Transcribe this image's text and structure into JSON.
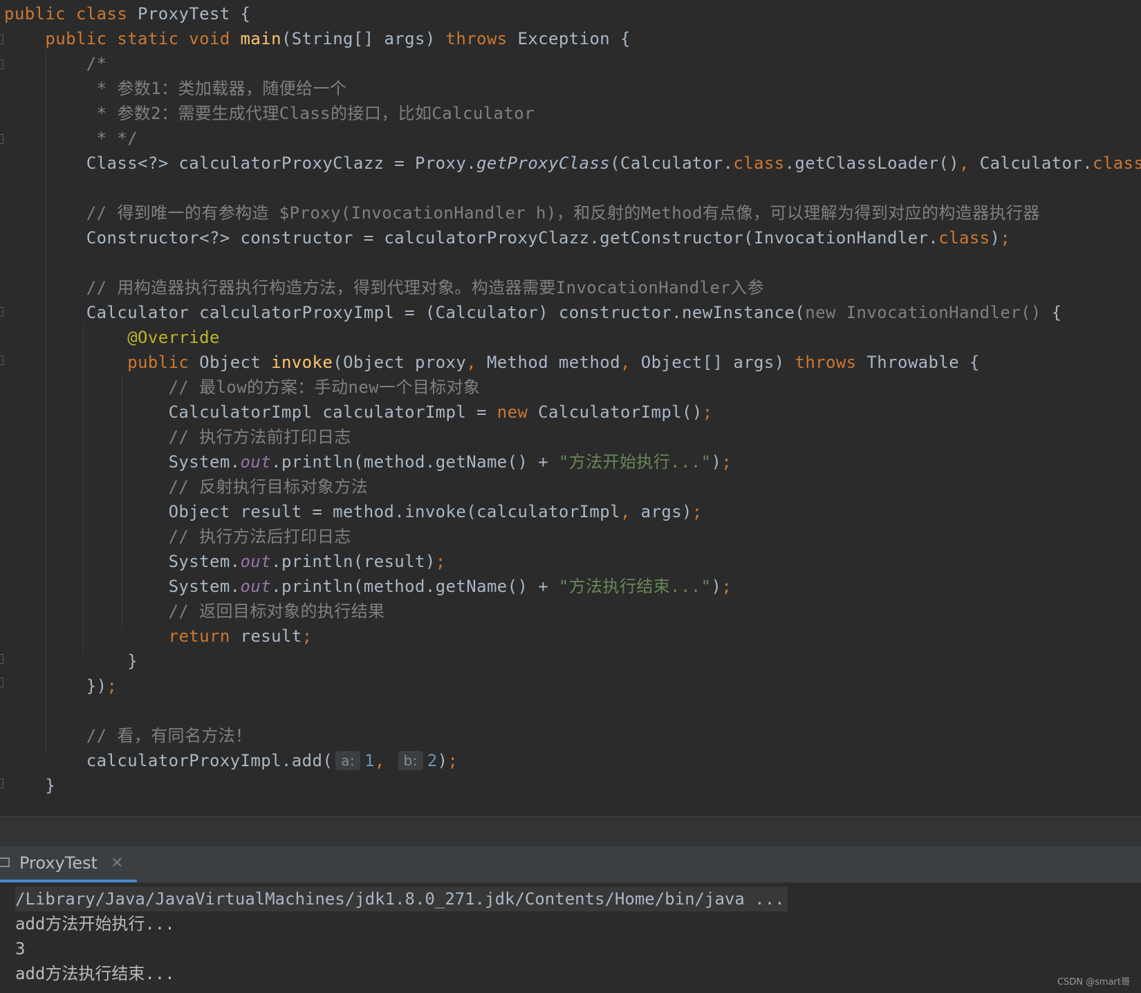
{
  "code_lines": [
    [
      {
        "t": "public class ",
        "c": "kw"
      },
      {
        "t": "ProxyTest {"
      }
    ],
    [
      {
        "t": "    "
      },
      {
        "t": "public static void ",
        "c": "kw"
      },
      {
        "t": "main",
        "c": "fn"
      },
      {
        "t": "(String[] args) "
      },
      {
        "t": "throws ",
        "c": "kw"
      },
      {
        "t": "Exception {"
      }
    ],
    [
      {
        "t": "        /*",
        "c": "cmt"
      }
    ],
    [
      {
        "t": "         * 参数1：类加载器，随便给一个",
        "c": "cmt"
      }
    ],
    [
      {
        "t": "         * 参数2：需要生成代理Class的接口，比如Calculator",
        "c": "cmt"
      }
    ],
    [
      {
        "t": "         * */",
        "c": "cmt"
      }
    ],
    [
      {
        "t": "        Class<?> calculatorProxyClazz = Proxy."
      },
      {
        "t": "getProxyClass",
        "c": "ital"
      },
      {
        "t": "(Calculator."
      },
      {
        "t": "class",
        "c": "kw"
      },
      {
        "t": ".getClassLoader()"
      },
      {
        "t": ", ",
        "c": "kw"
      },
      {
        "t": "Calculator."
      },
      {
        "t": "class",
        "c": "kw"
      },
      {
        "t": ")"
      },
      {
        "t": ";",
        "c": "kw"
      }
    ],
    [],
    [
      {
        "t": "        // 得到唯一的有参构造 $Proxy(InvocationHandler h)，和反射的Method有点像，可以理解为得到对应的构造器执行器",
        "c": "cmt"
      }
    ],
    [
      {
        "t": "        Constructor<?> constructor = calculatorProxyClazz.getConstructor(InvocationHandler."
      },
      {
        "t": "class",
        "c": "kw"
      },
      {
        "t": ")"
      },
      {
        "t": ";",
        "c": "kw"
      }
    ],
    [],
    [
      {
        "t": "        // 用构造器执行器执行构造方法，得到代理对象。构造器需要InvocationHandler入参",
        "c": "cmt"
      }
    ],
    [
      {
        "t": "        Calculator calculatorProxyImpl = (Calculator) constructor.newInstance("
      },
      {
        "t": "new InvocationHandler()",
        "c": "dim"
      },
      {
        "t": " {"
      }
    ],
    [
      {
        "t": "            "
      },
      {
        "t": "@Override",
        "c": "ann"
      }
    ],
    [
      {
        "t": "            "
      },
      {
        "t": "public ",
        "c": "kw"
      },
      {
        "t": "Object "
      },
      {
        "t": "invoke",
        "c": "fn"
      },
      {
        "t": "(Object proxy"
      },
      {
        "t": ", ",
        "c": "kw"
      },
      {
        "t": "Method method"
      },
      {
        "t": ", ",
        "c": "kw"
      },
      {
        "t": "Object[] args) "
      },
      {
        "t": "throws ",
        "c": "kw"
      },
      {
        "t": "Throwable {"
      }
    ],
    [
      {
        "t": "                // 最low的方案：手动new一个目标对象",
        "c": "cmt"
      }
    ],
    [
      {
        "t": "                CalculatorImpl calculatorImpl = "
      },
      {
        "t": "new ",
        "c": "kw"
      },
      {
        "t": "CalculatorImpl()"
      },
      {
        "t": ";",
        "c": "kw"
      }
    ],
    [
      {
        "t": "                // 执行方法前打印日志",
        "c": "cmt"
      }
    ],
    [
      {
        "t": "                System."
      },
      {
        "t": "out",
        "c": "fld"
      },
      {
        "t": ".println(method.getName() + "
      },
      {
        "t": "\"方法开始执行...\"",
        "c": "str"
      },
      {
        "t": ")"
      },
      {
        "t": ";",
        "c": "kw"
      }
    ],
    [
      {
        "t": "                // 反射执行目标对象方法",
        "c": "cmt"
      }
    ],
    [
      {
        "t": "                Object result = method.invoke(calculatorImpl"
      },
      {
        "t": ", ",
        "c": "kw"
      },
      {
        "t": "args)"
      },
      {
        "t": ";",
        "c": "kw"
      }
    ],
    [
      {
        "t": "                // 执行方法后打印日志",
        "c": "cmt"
      }
    ],
    [
      {
        "t": "                System."
      },
      {
        "t": "out",
        "c": "fld"
      },
      {
        "t": ".println(result)"
      },
      {
        "t": ";",
        "c": "kw"
      }
    ],
    [
      {
        "t": "                System."
      },
      {
        "t": "out",
        "c": "fld"
      },
      {
        "t": ".println(method.getName() + "
      },
      {
        "t": "\"方法执行结束...\"",
        "c": "str"
      },
      {
        "t": ")"
      },
      {
        "t": ";",
        "c": "kw"
      }
    ],
    [
      {
        "t": "                // 返回目标对象的执行结果",
        "c": "cmt"
      }
    ],
    [
      {
        "t": "                "
      },
      {
        "t": "return ",
        "c": "kw"
      },
      {
        "t": "result"
      },
      {
        "t": ";",
        "c": "kw"
      }
    ],
    [
      {
        "t": "            }"
      }
    ],
    [
      {
        "t": "        })"
      },
      {
        "t": ";",
        "c": "kw"
      }
    ],
    [],
    [
      {
        "t": "        // 看，有同名方法！",
        "c": "cmt"
      }
    ],
    [
      {
        "t": "        calculatorProxyImpl.add("
      },
      {
        "hint": "a:"
      },
      {
        "t": "1",
        "c": "num"
      },
      {
        "t": ", ",
        "c": "kw"
      },
      {
        "hint": "b:"
      },
      {
        "t": "2",
        "c": "num"
      },
      {
        "t": ")"
      },
      {
        "t": ";",
        "c": "kw"
      }
    ],
    [
      {
        "t": "    }"
      }
    ]
  ],
  "run_panel": {
    "tab_label": "ProxyTest",
    "close_symbol": "✕",
    "output": [
      "/Library/Java/JavaVirtualMachines/jdk1.8.0_271.jdk/Contents/Home/bin/java ...",
      "add方法开始执行...",
      "3",
      "add方法执行结束..."
    ]
  },
  "watermark": "CSDN @smart哥",
  "colors": {
    "background": "#2b2b2b",
    "keyword": "#cc7832",
    "comment": "#808080",
    "annotation": "#bbb529",
    "string": "#6a8759",
    "number": "#6897bb",
    "method_decl": "#ffc66d",
    "static_field": "#9876aa",
    "default_text": "#a9b7c6"
  }
}
